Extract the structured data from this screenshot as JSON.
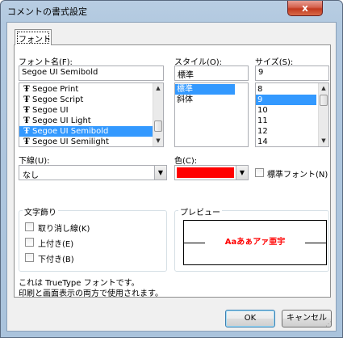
{
  "window": {
    "title": "コメントの書式設定",
    "close_label": "x"
  },
  "tabs": [
    {
      "label": "フォント"
    }
  ],
  "font_name": {
    "label": "フォント名(F):",
    "value": "Segoe UI Semibold",
    "items": [
      "Segoe Print",
      "Segoe Script",
      "Segoe UI",
      "Segoe UI Light",
      "Segoe UI Semibold",
      "Segoe UI Semilight"
    ],
    "selected_index": 4,
    "font_type_icon": "truetype-icon"
  },
  "style": {
    "label": "スタイル(O):",
    "value": "標準",
    "items": [
      "標準",
      "斜体"
    ],
    "selected_index": 0
  },
  "size": {
    "label": "サイズ(S):",
    "value": "9",
    "items": [
      "8",
      "9",
      "10",
      "11",
      "12",
      "14"
    ],
    "selected_index": 1
  },
  "underline": {
    "label": "下線(U):",
    "value": "なし"
  },
  "color": {
    "label": "色(C):",
    "value_hex": "#ff0000",
    "normal_font_label": "標準フォント(N)",
    "normal_font_checked": false
  },
  "effects": {
    "title": "文字飾り",
    "items": [
      {
        "label": "取り消し線(K)",
        "checked": false
      },
      {
        "label": "上付き(E)",
        "checked": false
      },
      {
        "label": "下付き(B)",
        "checked": false
      }
    ]
  },
  "preview": {
    "title": "プレビュー",
    "sample_text": "Aaあぁアァ亜宇",
    "sample_color": "#ff0000"
  },
  "info": {
    "line1": "これは TrueType フォントです。",
    "line2": "印刷と画面表示の両方で使用されます。"
  },
  "buttons": {
    "ok": "OK",
    "cancel": "キャンセル"
  }
}
